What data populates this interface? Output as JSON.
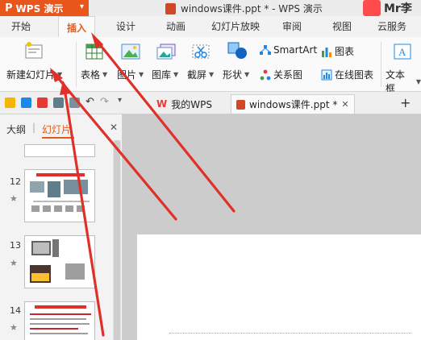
{
  "title_bar": {
    "app_name": "WPS 演示",
    "doc_title": "windows课件.ppt * - WPS 演示",
    "user_name": "Mr李"
  },
  "ribbon_tabs": [
    "开始",
    "插入",
    "设计",
    "动画",
    "幻灯片放映",
    "审阅",
    "视图",
    "云服务"
  ],
  "active_tab": "插入",
  "ribbon": {
    "new_slide": "新建幻灯片",
    "table": "表格",
    "picture": "图片",
    "gallery": "图库",
    "screenshot": "截屏",
    "shapes": "形状",
    "smartart": "SmartArt",
    "relation_chart": "关系图",
    "chart": "图表",
    "online_chart": "在线图表",
    "textbox": "文本框"
  },
  "doc_tabs": [
    {
      "label": "我的WPS"
    },
    {
      "label": "windows课件.ppt *"
    }
  ],
  "left_panel": {
    "outline_tab": "大纲",
    "slides_tab": "幻灯片",
    "slide_numbers": [
      "12",
      "13",
      "14"
    ]
  },
  "colors": {
    "brand_orange": "#e8561b",
    "accent_red": "#e0302a"
  }
}
